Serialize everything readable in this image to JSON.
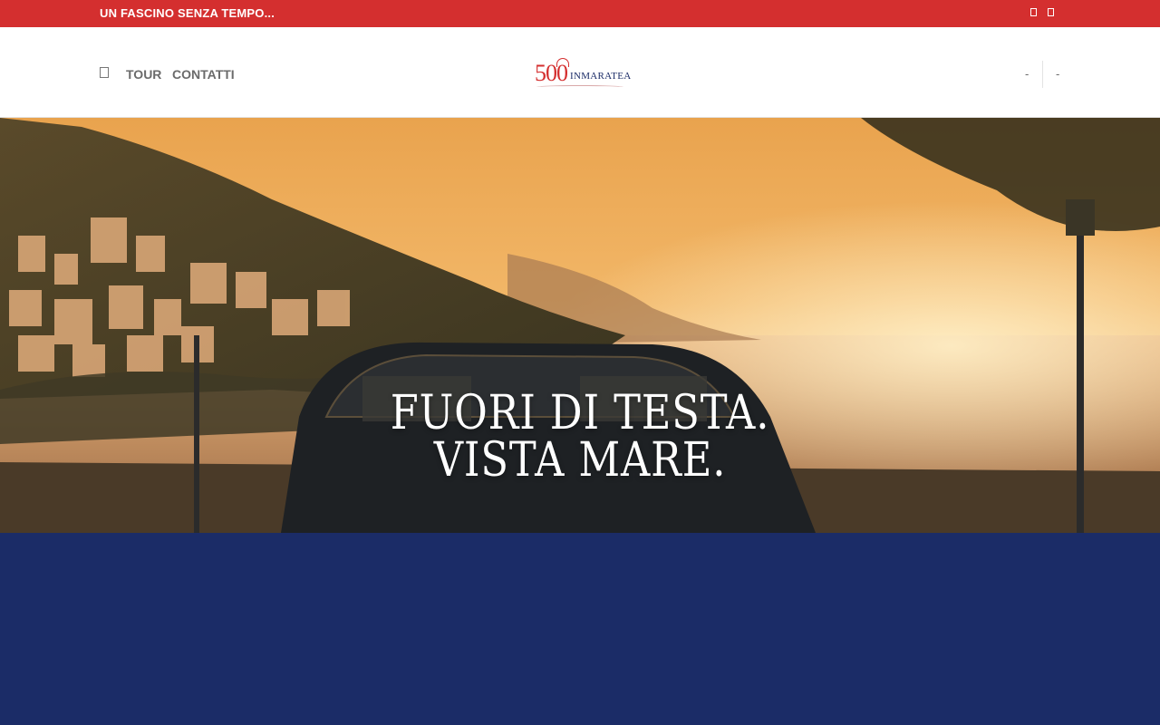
{
  "topbar": {
    "tagline": "UN FASCINO SENZA TEMPO...",
    "social_icons": [
      "social-icon-1",
      "social-icon-2"
    ]
  },
  "header": {
    "nav": {
      "home_icon": "home-icon",
      "links": [
        "TOUR",
        "CONTATTI"
      ]
    },
    "logo": {
      "number": "500",
      "word": "INMARATEA"
    },
    "right_items": [
      "-",
      "-"
    ]
  },
  "hero": {
    "title_line_1": "FUORI DI TESTA.",
    "title_line_2": "VISTA MARE."
  },
  "colors": {
    "topbar": "#d42f2f",
    "band": "#1b2c67",
    "nav_text": "#6b6b6b"
  }
}
